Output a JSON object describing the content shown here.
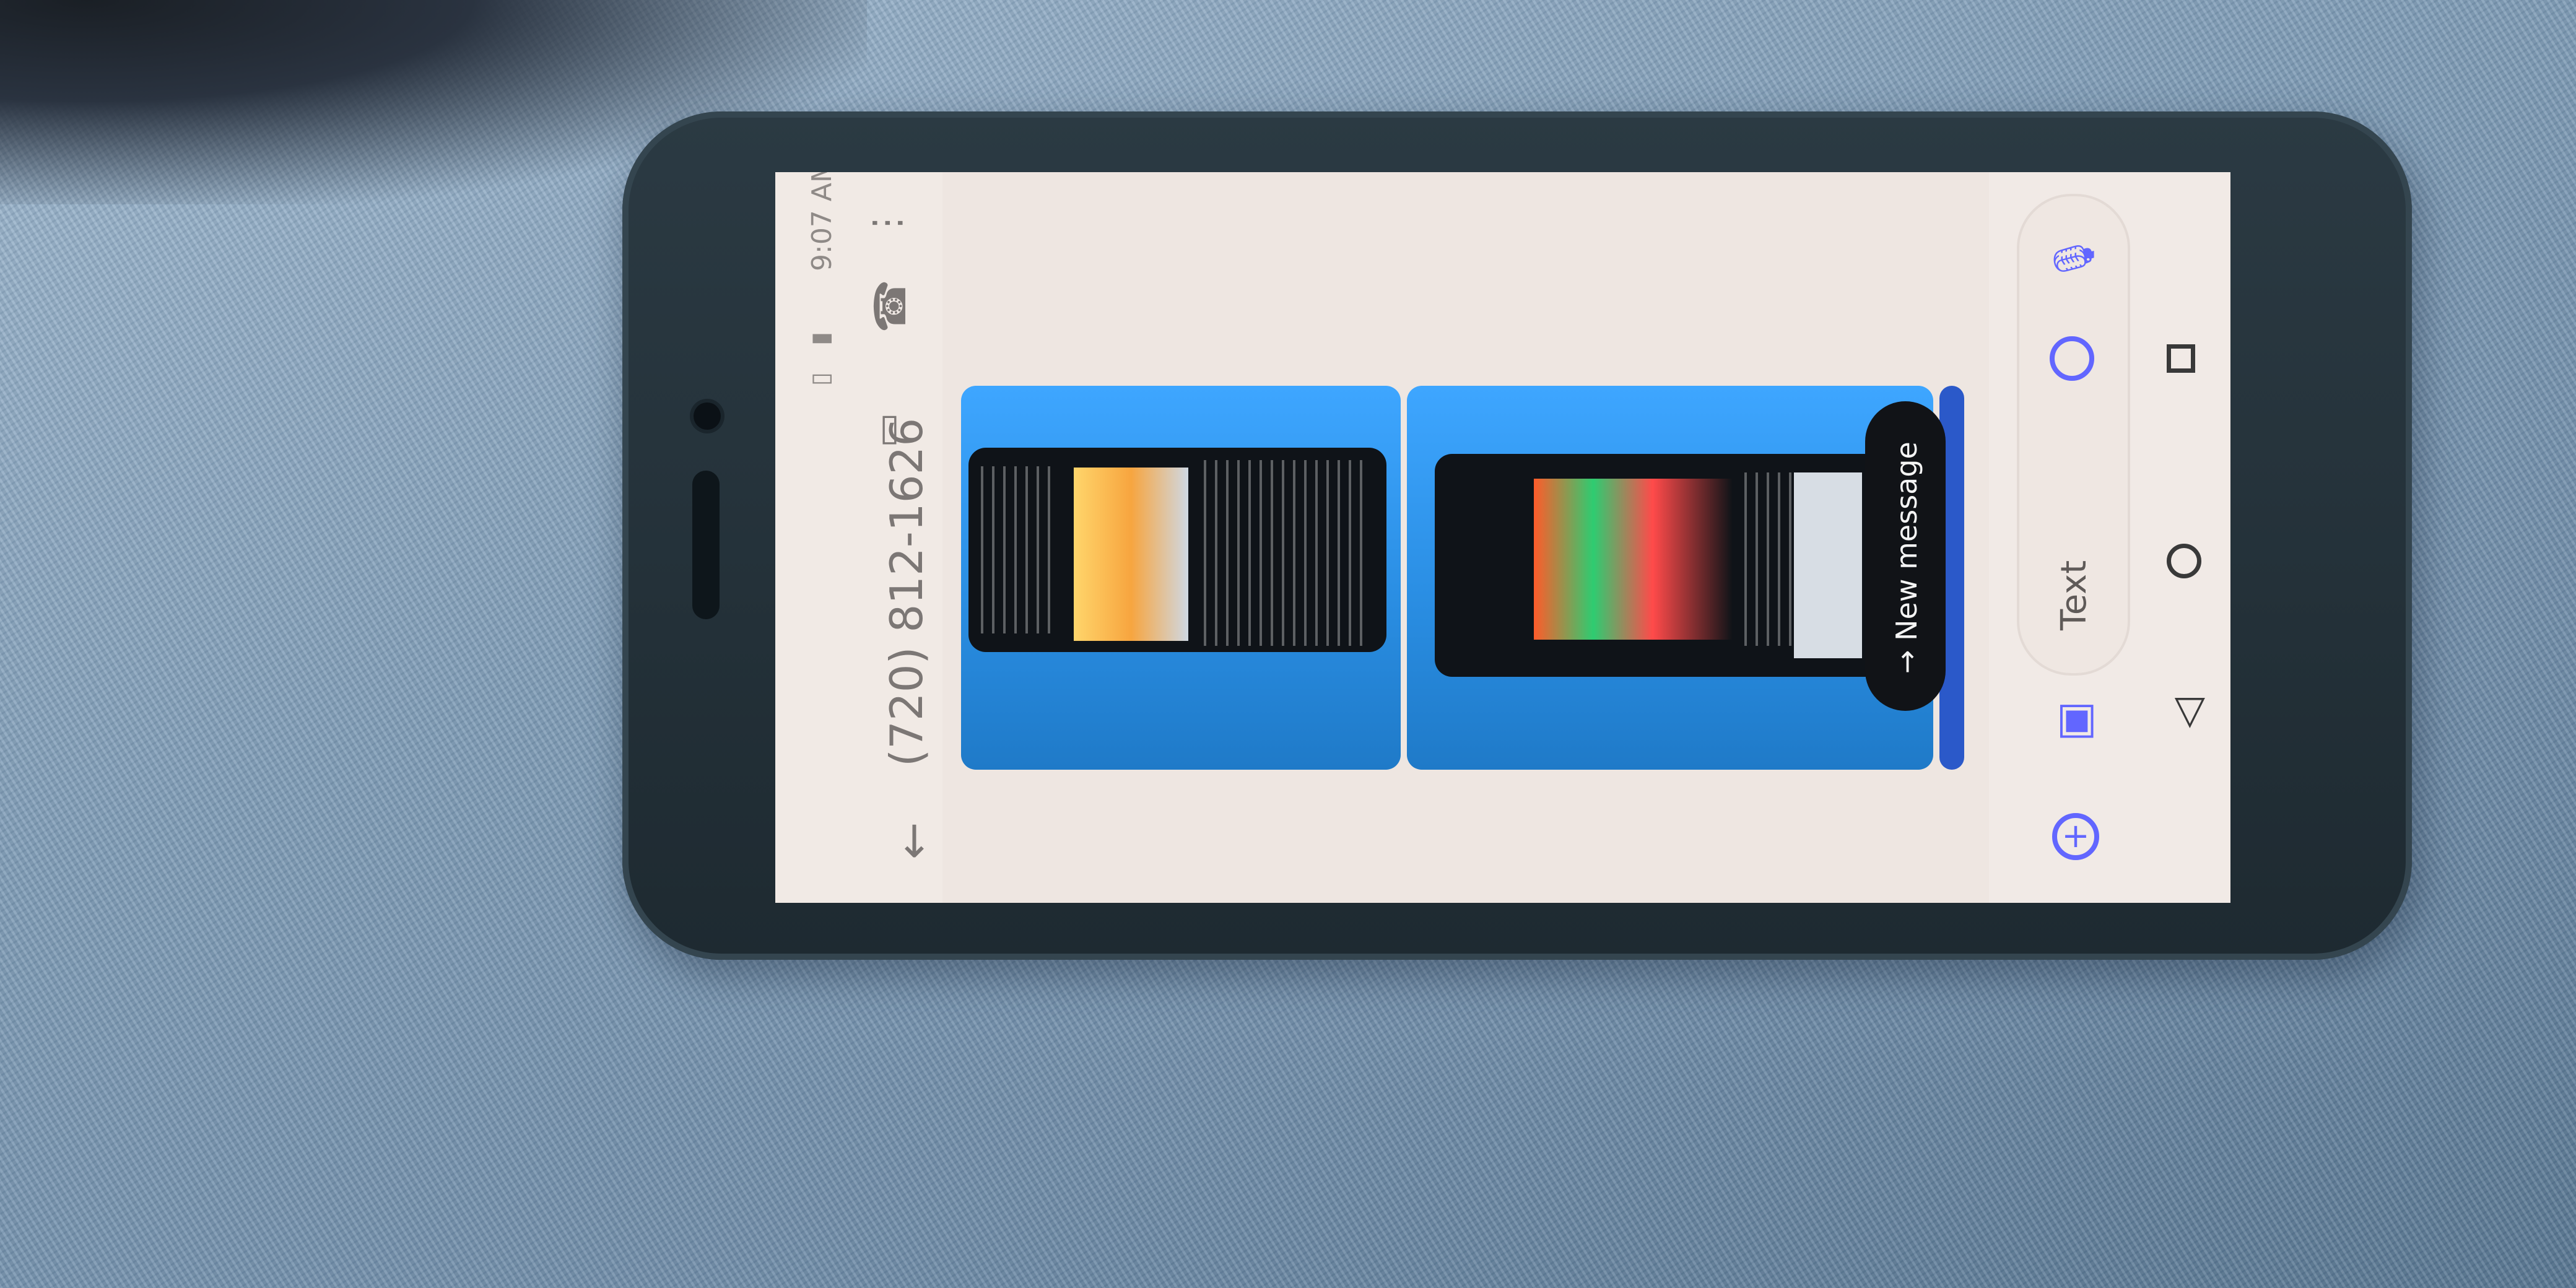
{
  "status": {
    "time": "9:07",
    "ampm": "AM"
  },
  "conversation": {
    "contact": "(720) 812-1626"
  },
  "message_pill": {
    "new_message_label": "New message"
  },
  "compose": {
    "placeholder": "Text"
  },
  "colors": {
    "accent": "#6266ff",
    "screen_bg": "#eee6e1",
    "phone_bezel": "#1e2a31",
    "denim": "#7f9cb6"
  },
  "icons": {
    "back": "back-arrow-icon",
    "call": "call-icon",
    "video": "video-icon",
    "more": "more-icon",
    "mic": "microphone-icon",
    "emoji": "emoji-icon",
    "gallery": "gallery-icon",
    "add": "add-icon",
    "nav_recent": "recent-apps-icon",
    "nav_home": "home-icon",
    "nav_back": "nav-back-icon"
  }
}
